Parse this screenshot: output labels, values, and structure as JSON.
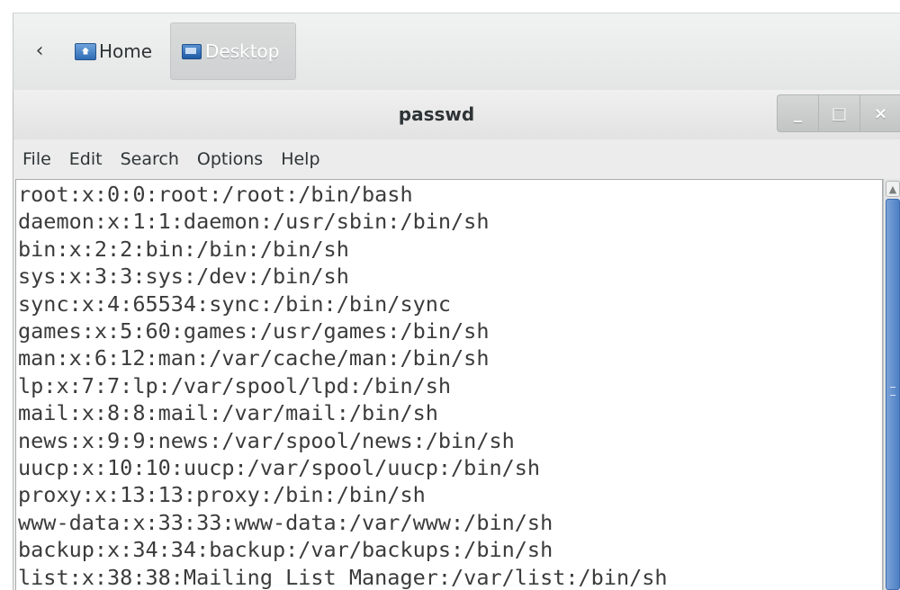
{
  "path_bar": {
    "back_icon": "chevron-left-icon",
    "home_label": "Home",
    "home_icon": "home-folder-icon",
    "desktop_label": "Desktop",
    "desktop_icon": "desktop-icon"
  },
  "window": {
    "title": "passwd",
    "controls": {
      "minimize": "_",
      "maximize": "□",
      "close": "×"
    }
  },
  "menu": {
    "items": [
      "File",
      "Edit",
      "Search",
      "Options",
      "Help"
    ]
  },
  "editor": {
    "lines": [
      "root:x:0:0:root:/root:/bin/bash",
      "daemon:x:1:1:daemon:/usr/sbin:/bin/sh",
      "bin:x:2:2:bin:/bin:/bin/sh",
      "sys:x:3:3:sys:/dev:/bin/sh",
      "sync:x:4:65534:sync:/bin:/bin/sync",
      "games:x:5:60:games:/usr/games:/bin/sh",
      "man:x:6:12:man:/var/cache/man:/bin/sh",
      "lp:x:7:7:lp:/var/spool/lpd:/bin/sh",
      "mail:x:8:8:mail:/var/mail:/bin/sh",
      "news:x:9:9:news:/var/spool/news:/bin/sh",
      "uucp:x:10:10:uucp:/var/spool/uucp:/bin/sh",
      "proxy:x:13:13:proxy:/bin:/bin/sh",
      "www-data:x:33:33:www-data:/var/www:/bin/sh",
      "backup:x:34:34:backup:/var/backups:/bin/sh",
      "list:x:38:38:Mailing List Manager:/var/list:/bin/sh"
    ]
  },
  "colors": {
    "scrollbar_accent": "#4d80c4",
    "text": "#3b3b3b"
  }
}
